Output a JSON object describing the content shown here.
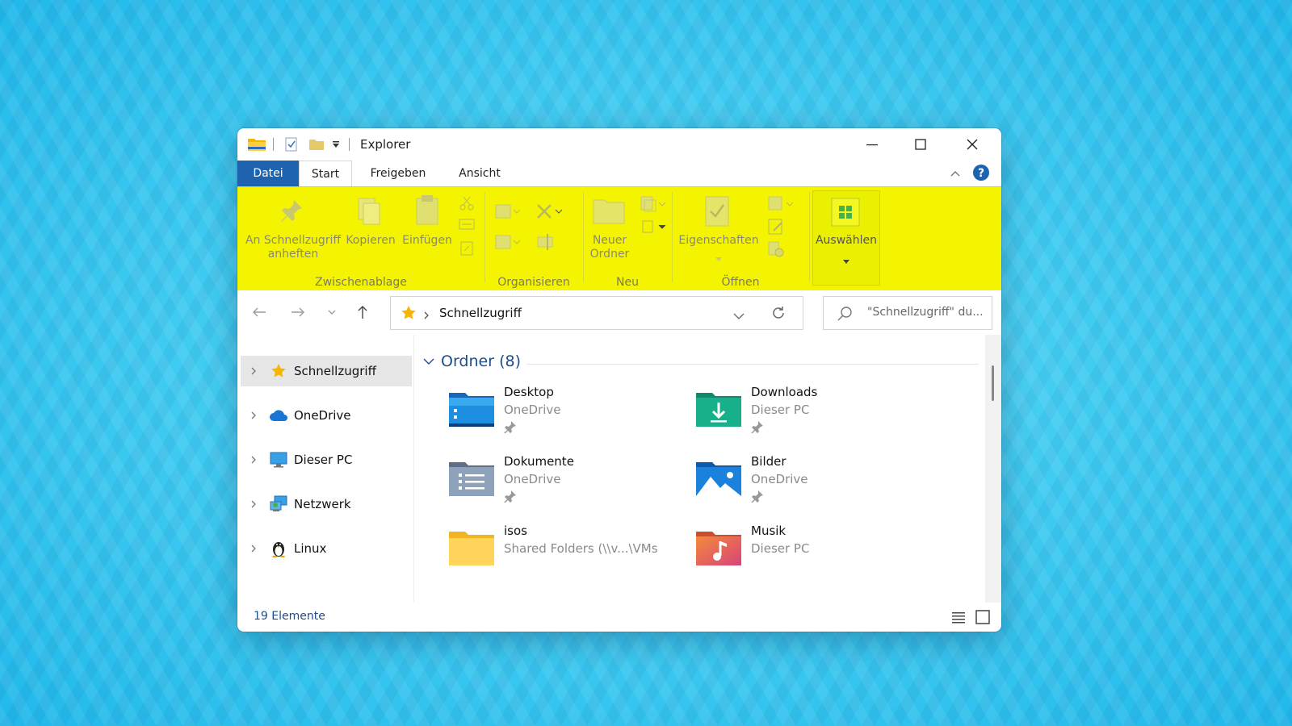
{
  "window": {
    "title": "Explorer",
    "controls": {
      "minimize": "minimize-icon",
      "maximize": "maximize-icon",
      "close": "close-icon"
    }
  },
  "tabs": {
    "file": "Datei",
    "start": "Start",
    "share": "Freigeben",
    "view": "Ansicht"
  },
  "ribbon": {
    "highlight_color": "#f4f400",
    "pin_label_1": "An Schnellzugriff",
    "pin_label_2": "anheften",
    "copy": "Kopieren",
    "paste": "Einfügen",
    "new_folder_1": "Neuer",
    "new_folder_2": "Ordner",
    "properties": "Eigenschaften",
    "select": "Auswählen",
    "groups": {
      "clipboard": "Zwischenablage",
      "organize": "Organisieren",
      "new": "Neu",
      "open": "Öffnen"
    }
  },
  "address": {
    "path": "Schnellzugriff",
    "search_placeholder": "\"Schnellzugriff\" du..."
  },
  "sidebar": {
    "items": [
      {
        "label": "Schnellzugriff",
        "icon": "star-icon",
        "selected": true
      },
      {
        "label": "OneDrive",
        "icon": "cloud-icon"
      },
      {
        "label": "Dieser PC",
        "icon": "monitor-icon"
      },
      {
        "label": "Netzwerk",
        "icon": "network-icon"
      },
      {
        "label": "Linux",
        "icon": "penguin-icon"
      }
    ]
  },
  "content": {
    "group_title": "Ordner (8)",
    "folders": [
      {
        "name": "Desktop",
        "location": "OneDrive",
        "pinned": true,
        "icon": "desktop-folder-icon"
      },
      {
        "name": "Downloads",
        "location": "Dieser PC",
        "pinned": true,
        "icon": "downloads-folder-icon"
      },
      {
        "name": "Dokumente",
        "location": "OneDrive",
        "pinned": true,
        "icon": "documents-folder-icon"
      },
      {
        "name": "Bilder",
        "location": "OneDrive",
        "pinned": true,
        "icon": "pictures-folder-icon"
      },
      {
        "name": "isos",
        "location": "Shared Folders (\\\\v...\\VMs",
        "pinned": false,
        "icon": "folder-icon"
      },
      {
        "name": "Musik",
        "location": "Dieser PC",
        "pinned": false,
        "icon": "music-folder-icon"
      }
    ]
  },
  "status": {
    "count": "19 Elemente"
  }
}
